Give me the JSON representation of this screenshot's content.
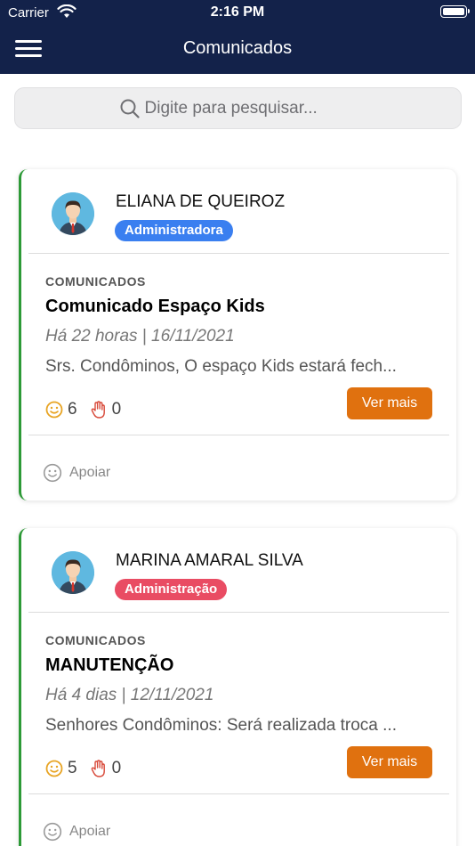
{
  "status_bar": {
    "carrier": "Carrier",
    "time": "2:16 PM"
  },
  "nav": {
    "title": "Comunicados"
  },
  "search": {
    "placeholder": "Digite para pesquisar..."
  },
  "colors": {
    "nav_bg": "#13224a",
    "accent_green": "#2d9a37",
    "button_orange": "#e0710f",
    "badge_blue": "#3a7ff0",
    "badge_red": "#e94c63"
  },
  "posts": [
    {
      "author": "ELIANA DE QUEIROZ",
      "role": "Administradora",
      "role_color": "#3a7ff0",
      "category": "COMUNICADOS",
      "title": "Comunicado Espaço Kids",
      "meta": "Há 22 horas | 16/11/2021",
      "preview": "Srs. Condôminos, O espaço Kids estará fech...",
      "smile_count": "6",
      "hand_count": "0",
      "more_label": "Ver mais",
      "support_label": "Apoiar"
    },
    {
      "author": "MARINA AMARAL SILVA",
      "role": "Administração",
      "role_color": "#e94c63",
      "category": "COMUNICADOS",
      "title": "MANUTENÇÃO",
      "meta": "Há 4 dias | 12/11/2021",
      "preview": "Senhores Condôminos: Será realizada troca ...",
      "smile_count": "5",
      "hand_count": "0",
      "more_label": "Ver mais",
      "support_label": "Apoiar"
    }
  ]
}
